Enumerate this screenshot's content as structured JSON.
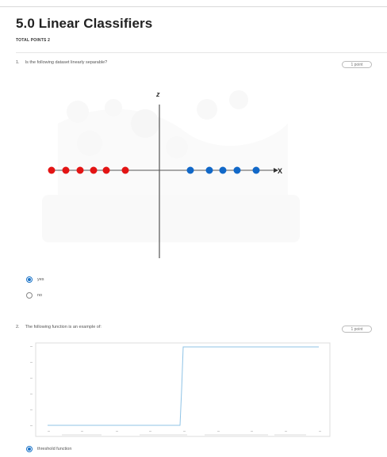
{
  "form": {
    "title": "5.0 Linear Classifiers",
    "total_points": "TOTAL POINTS 2"
  },
  "questions": [
    {
      "number": "1.",
      "text": "Is the following dataset linearly separable?",
      "points": "1 point",
      "figure": {
        "z_label": "z",
        "x_label": "X",
        "red_point_count": 6,
        "blue_point_count": 5,
        "colors": {
          "red": "#e31414",
          "blue": "#1168c8",
          "axis": "#333333"
        }
      },
      "options": [
        {
          "label": "yes",
          "selected": true
        },
        {
          "label": "no",
          "selected": false
        }
      ]
    },
    {
      "number": "2.",
      "text": "The following function is an example of:",
      "points": "1 point",
      "figure": {
        "line_color": "#8fc3e6",
        "step_location": 0,
        "x_range": [
          -5,
          5
        ],
        "y_range": [
          0,
          1
        ]
      },
      "options": [
        {
          "label": "threshold function",
          "selected": true
        }
      ]
    }
  ]
}
